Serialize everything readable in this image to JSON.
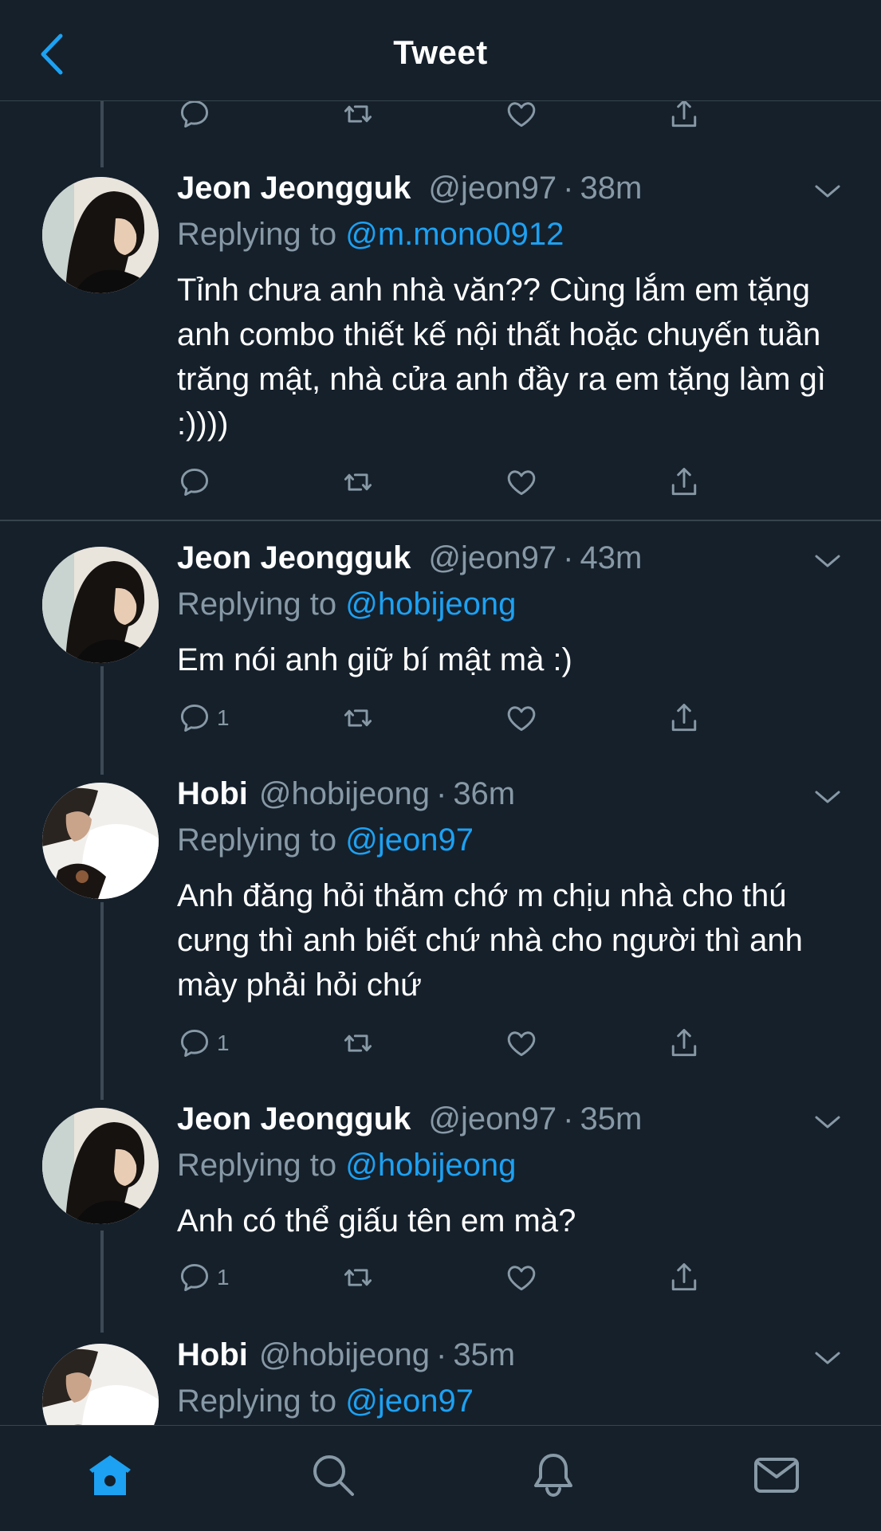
{
  "header": {
    "title": "Tweet"
  },
  "colors": {
    "background": "#15202b",
    "accent": "#1da1f2",
    "muted": "#8899a6",
    "border": "#38444d"
  },
  "replying_prefix": "Replying to",
  "tweets": [
    {
      "name": "Jeon Jeongguk",
      "handle": "@jeon97",
      "time": "38m",
      "reply_to": "@m.mono0912",
      "text": "Tỉnh chưa anh nhà văn?? Cùng lắm em tặng anh combo thiết kế nội thất hoặc chuyến tuần trăng mật, nhà cửa anh đầy ra em tặng làm gì :))))",
      "reply_count": ""
    },
    {
      "name": "Jeon Jeongguk",
      "handle": "@jeon97",
      "time": "43m",
      "reply_to": "@hobijeong",
      "text": "Em nói anh giữ bí mật mà :)",
      "reply_count": "1"
    },
    {
      "name": "Hobi",
      "handle": "@hobijeong",
      "time": "36m",
      "reply_to": "@jeon97",
      "text": "Anh đăng hỏi thăm chớ m chịu nhà cho thú cưng thì anh biết chứ nhà cho người thì anh mày phải hỏi chứ",
      "reply_count": "1"
    },
    {
      "name": "Jeon Jeongguk",
      "handle": "@jeon97",
      "time": "35m",
      "reply_to": "@hobijeong",
      "text": "Anh có thể giấu tên em mà?",
      "reply_count": "1"
    },
    {
      "name": "Hobi",
      "handle": "@hobijeong",
      "time": "35m",
      "reply_to": "@jeon97",
      "text": "",
      "reply_count": ""
    }
  ],
  "tabbar": {
    "items": [
      "home-icon",
      "search-icon",
      "notifications-icon",
      "messages-icon"
    ],
    "active": "home-icon"
  }
}
